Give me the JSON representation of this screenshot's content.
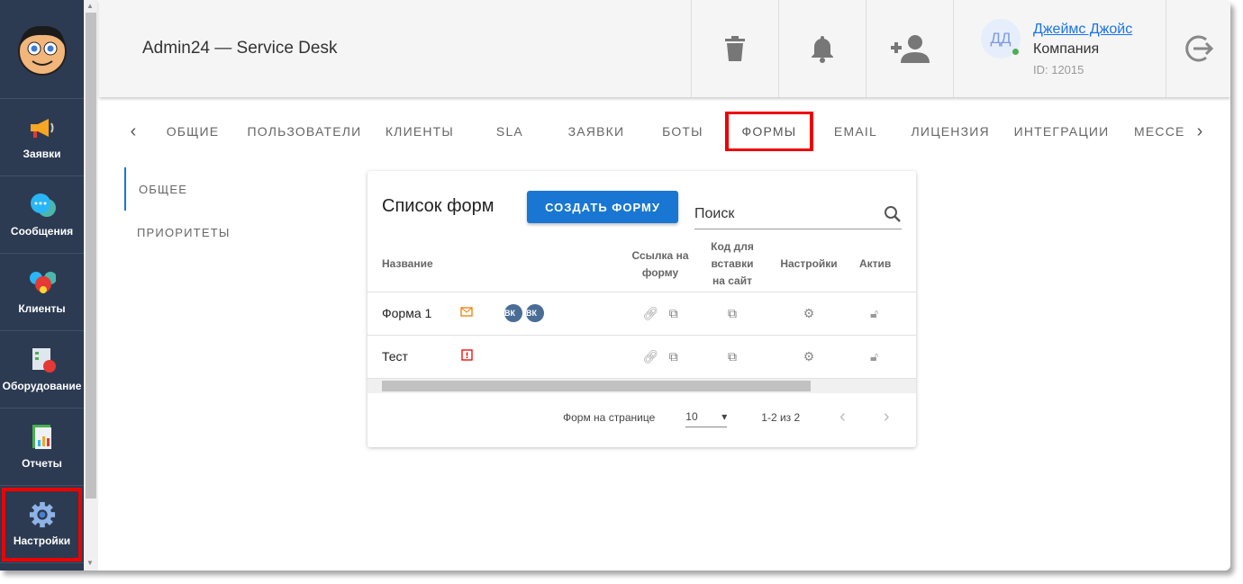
{
  "header": {
    "title": "Admin24 — Service Desk",
    "user": {
      "initials": "ДД",
      "name": "Джеймс Джойс",
      "company": "Компания",
      "id": "ID: 12015"
    }
  },
  "sidebar": {
    "items": [
      {
        "label": "Заявки",
        "icon": "megaphone-icon"
      },
      {
        "label": "Сообщения",
        "icon": "chat-icon"
      },
      {
        "label": "Клиенты",
        "icon": "clients-icon"
      },
      {
        "label": "Оборудование",
        "icon": "equipment-icon"
      },
      {
        "label": "Отчеты",
        "icon": "reports-icon"
      },
      {
        "label": "Настройки",
        "icon": "gear-icon"
      }
    ]
  },
  "tabs": [
    "ОБЩИЕ",
    "ПОЛЬЗОВАТЕЛИ",
    "КЛИЕНТЫ",
    "SLA",
    "ЗАЯВКИ",
    "БОТЫ",
    "ФОРМЫ",
    "EMAIL",
    "ЛИЦЕНЗИЯ",
    "ИНТЕГРАЦИИ",
    "МЕССЕ"
  ],
  "subnav": [
    "ОБЩЕЕ",
    "ПРИОРИТЕТЫ"
  ],
  "card": {
    "title": "Список форм",
    "create_label": "СОЗДАТЬ ФОРМУ",
    "search_placeholder": "Поиск",
    "columns": {
      "name": "Название",
      "link": "Ссылка на форму",
      "code": "Код для вставки на сайт",
      "settings": "Настройки",
      "active": "Актив"
    },
    "rows": [
      {
        "name": "Форма 1",
        "status_icon": "email-icon",
        "vk": [
          "ВК",
          "ВК"
        ]
      },
      {
        "name": "Тест",
        "status_icon": "alert-icon",
        "vk": []
      }
    ],
    "footer": {
      "per_page_label": "Форм на странице",
      "per_page": "10",
      "range": "1-2 из 2"
    }
  },
  "colors": {
    "sidebar": "#2c3b52",
    "accent": "#1976d2",
    "highlight": "#e00000"
  }
}
